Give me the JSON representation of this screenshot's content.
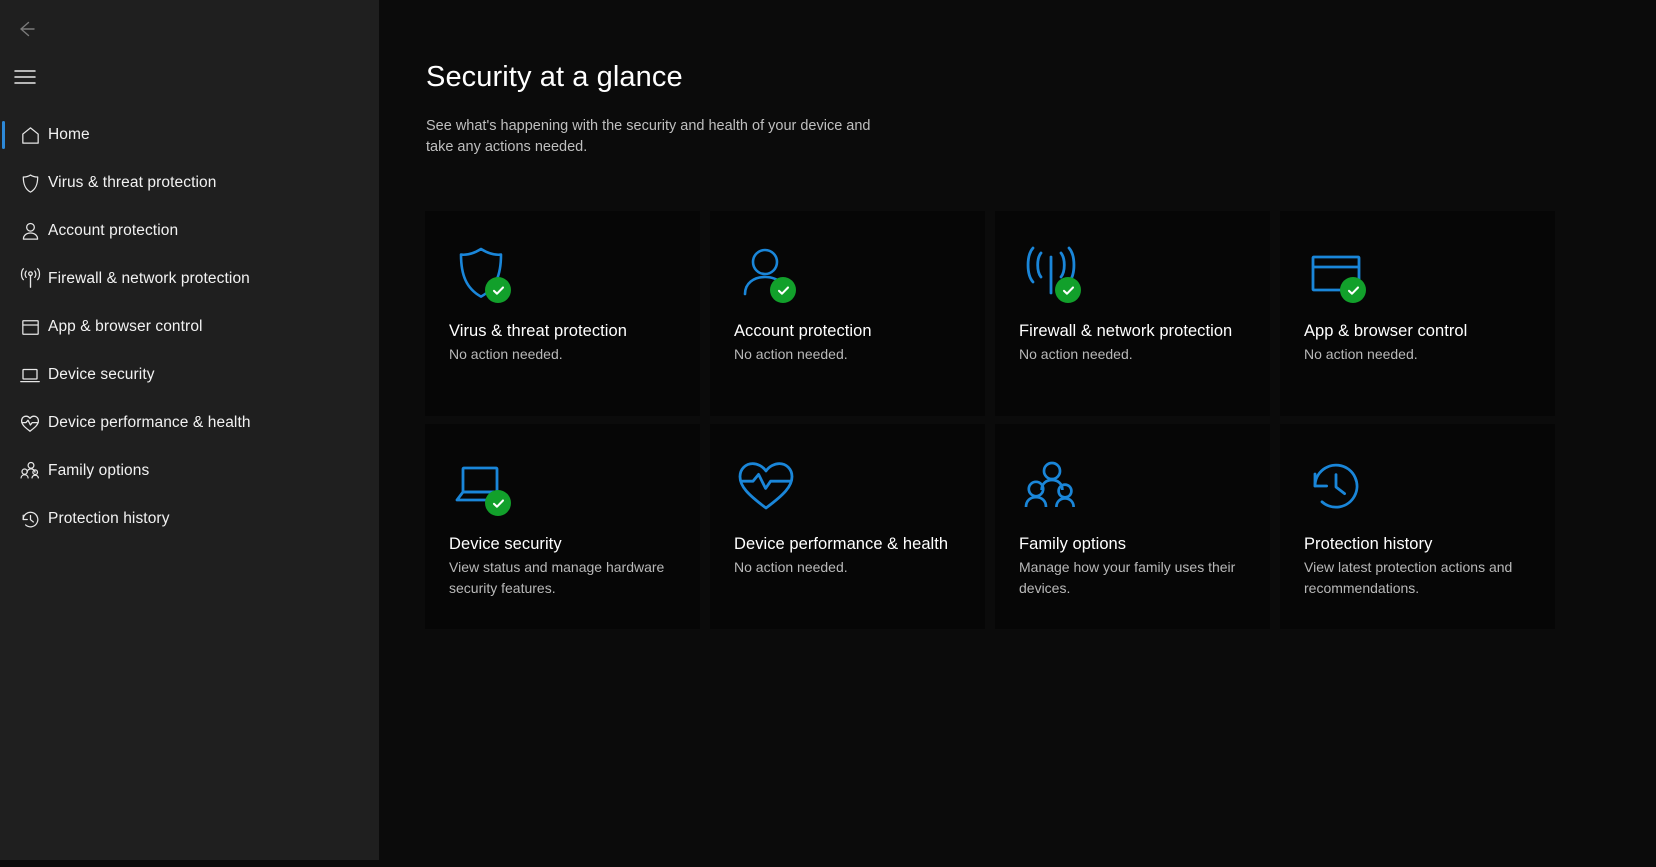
{
  "window": {
    "background_color": "#0b0b0b",
    "sidebar_color": "#1f1f1f",
    "accent_color": "#1a86d9",
    "status_ok_color": "#12a02b"
  },
  "sidebar": {
    "back_label": "Back",
    "back_icon": "arrow-left-icon",
    "menu_label": "Navigation menu",
    "menu_icon": "hamburger-menu-icon",
    "items": [
      {
        "label": "Home",
        "icon": "home-icon",
        "selected": true
      },
      {
        "label": "Virus & threat protection",
        "icon": "shield-icon",
        "selected": false
      },
      {
        "label": "Account protection",
        "icon": "person-icon",
        "selected": false
      },
      {
        "label": "Firewall & network protection",
        "icon": "wifi-signal-icon",
        "selected": false
      },
      {
        "label": "App & browser control",
        "icon": "window-icon",
        "selected": false
      },
      {
        "label": "Device security",
        "icon": "laptop-icon",
        "selected": false
      },
      {
        "label": "Device performance & health",
        "icon": "heart-pulse-icon",
        "selected": false
      },
      {
        "label": "Family options",
        "icon": "people-group-icon",
        "selected": false
      },
      {
        "label": "Protection history",
        "icon": "clock-history-icon",
        "selected": false
      }
    ]
  },
  "main": {
    "title": "Security at a glance",
    "subtitle": "See what's happening with the security and health of your device and take any actions needed.",
    "cards": [
      {
        "title": "Virus & threat protection",
        "desc": "No action needed.",
        "icon": "shield-icon",
        "badge": "check-circle-icon",
        "has_badge": true
      },
      {
        "title": "Account protection",
        "desc": "No action needed.",
        "icon": "person-icon",
        "badge": "check-circle-icon",
        "has_badge": true
      },
      {
        "title": "Firewall & network protection",
        "desc": "No action needed.",
        "icon": "wifi-signal-icon",
        "badge": "check-circle-icon",
        "has_badge": true
      },
      {
        "title": "App & browser control",
        "desc": "No action needed.",
        "icon": "window-icon",
        "badge": "check-circle-icon",
        "has_badge": true
      },
      {
        "title": "Device security",
        "desc": "View status and manage hardware security features.",
        "icon": "laptop-icon",
        "badge": "check-circle-icon",
        "has_badge": true
      },
      {
        "title": "Device performance & health",
        "desc": "No action needed.",
        "icon": "heart-pulse-icon",
        "badge": "",
        "has_badge": false
      },
      {
        "title": "Family options",
        "desc": "Manage how your family uses their devices.",
        "icon": "people-group-icon",
        "badge": "",
        "has_badge": false
      },
      {
        "title": "Protection history",
        "desc": "View latest protection actions and recommendations.",
        "icon": "clock-history-icon",
        "badge": "",
        "has_badge": false
      }
    ]
  }
}
